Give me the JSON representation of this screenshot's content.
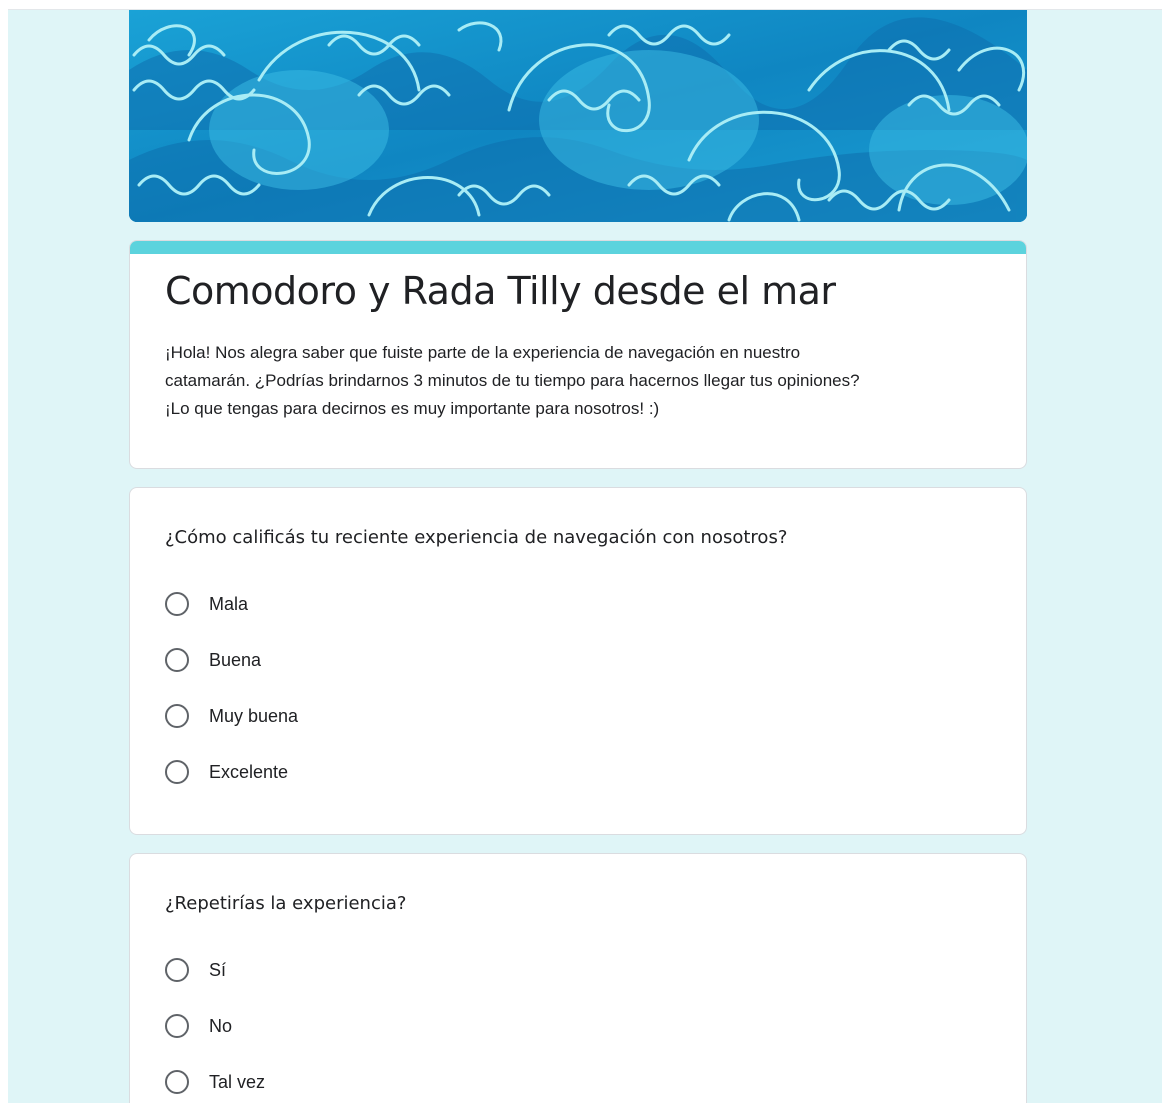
{
  "form": {
    "title": "Comodoro y Rada Tilly desde el mar",
    "description": "¡Hola! Nos alegra saber que fuiste parte de la experiencia de navegación en nuestro\ncatamarán. ¿Podrías brindarnos 3 minutos de tu tiempo para hacernos llegar tus opiniones?\n¡Lo que tengas para decirnos es muy importante para nosotros! :)"
  },
  "questions": [
    {
      "title": "¿Cómo calificás tu reciente experiencia de navegación con nosotros?",
      "options": [
        "Mala",
        "Buena",
        "Muy buena",
        "Excelente"
      ]
    },
    {
      "title": "¿Repetirías la experiencia?",
      "options": [
        "Sí",
        "No",
        "Tal vez"
      ]
    }
  ],
  "colors": {
    "background": "#dff5f7",
    "accent": "#5cd3dd",
    "banner_base": "#1592c9"
  }
}
